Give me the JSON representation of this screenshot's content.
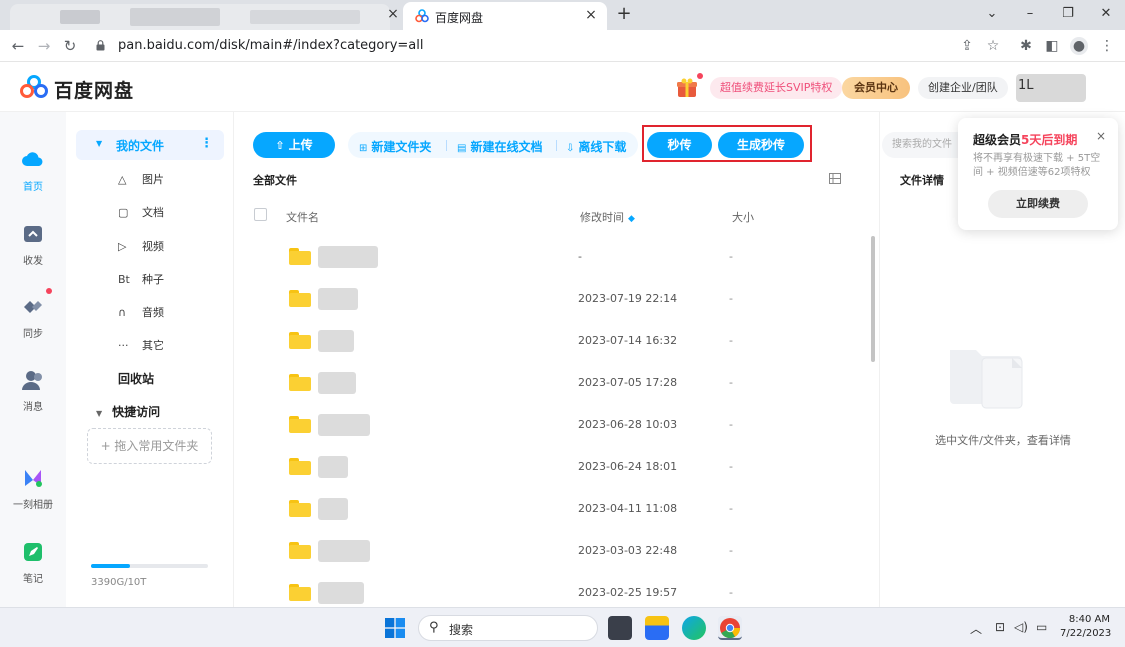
{
  "browser": {
    "active_tab_title": "百度网盘",
    "new_tab": "+",
    "close": "×",
    "url": "pan.baidu.com/disk/main#/index?category=all",
    "window_controls": [
      "⌄",
      "–",
      "❐",
      "✕"
    ]
  },
  "header": {
    "brand": "百度网盘",
    "promo": "超值续费延长SVIP特权",
    "vip_center": "会员中心",
    "enterprise": "创建企业/团队",
    "avatar_text": "1L"
  },
  "leftnav": [
    {
      "label": "首页",
      "icon": "cloud-icon"
    },
    {
      "label": "收发",
      "icon": "share-folder-icon"
    },
    {
      "label": "同步",
      "icon": "sync-icon"
    },
    {
      "label": "消息",
      "icon": "contacts-icon"
    },
    {
      "label": "一刻相册",
      "icon": "album-icon"
    },
    {
      "label": "笔记",
      "icon": "note-icon"
    }
  ],
  "sidebar": {
    "my_files": "我的文件",
    "more": "⋮",
    "categories": [
      {
        "icon": "△",
        "label": "图片"
      },
      {
        "icon": "▢",
        "label": "文档"
      },
      {
        "icon": "▷",
        "label": "视频"
      },
      {
        "icon": "Bt",
        "label": "种子"
      },
      {
        "icon": "∩",
        "label": "音频"
      },
      {
        "icon": "···",
        "label": "其它"
      }
    ],
    "recycle": "回收站",
    "quick_access": "快捷访问",
    "dropzone": "+ 拖入常用文件夹",
    "quota": "3390G/10T",
    "quota_fraction": 0.33
  },
  "toolbar": {
    "upload": "上传",
    "new_folder": "新建文件夹",
    "new_doc": "新建在线文档",
    "offline": "离线下载",
    "instant": "秒传",
    "gen_instant": "生成秒传"
  },
  "list": {
    "section_title": "全部文件",
    "col_name": "文件名",
    "col_time": "修改时间",
    "col_size": "大小",
    "rows": [
      {
        "time": "-",
        "size": "-"
      },
      {
        "time": "2023-07-19 22:14",
        "size": "-"
      },
      {
        "time": "2023-07-14 16:32",
        "size": "-"
      },
      {
        "time": "2023-07-05 17:28",
        "size": "-"
      },
      {
        "time": "2023-06-28 10:03",
        "size": "-"
      },
      {
        "time": "2023-06-24 18:01",
        "size": "-"
      },
      {
        "time": "2023-04-11 11:08",
        "size": "-"
      },
      {
        "time": "2023-03-03 22:48",
        "size": "-"
      },
      {
        "time": "2023-02-25 19:57",
        "size": "-"
      }
    ]
  },
  "rpanel": {
    "search_placeholder": "搜索我的文件",
    "detail_title": "文件详情",
    "empty_text": "选中文件/文件夹，查看详情"
  },
  "popup": {
    "title_prefix": "超级会员",
    "title_highlight": "5天后到期",
    "close": "×",
    "desc": "将不再享有极速下载 + 5T空间 + 视频倍速等62项特权",
    "button": "立即续费"
  },
  "taskbar": {
    "search": "搜索",
    "time": "8:40 AM",
    "date": "7/22/2023"
  },
  "colors": {
    "accent": "#06a7ff",
    "highlight_border": "#e0242e",
    "badge_red": "#f5445c"
  }
}
